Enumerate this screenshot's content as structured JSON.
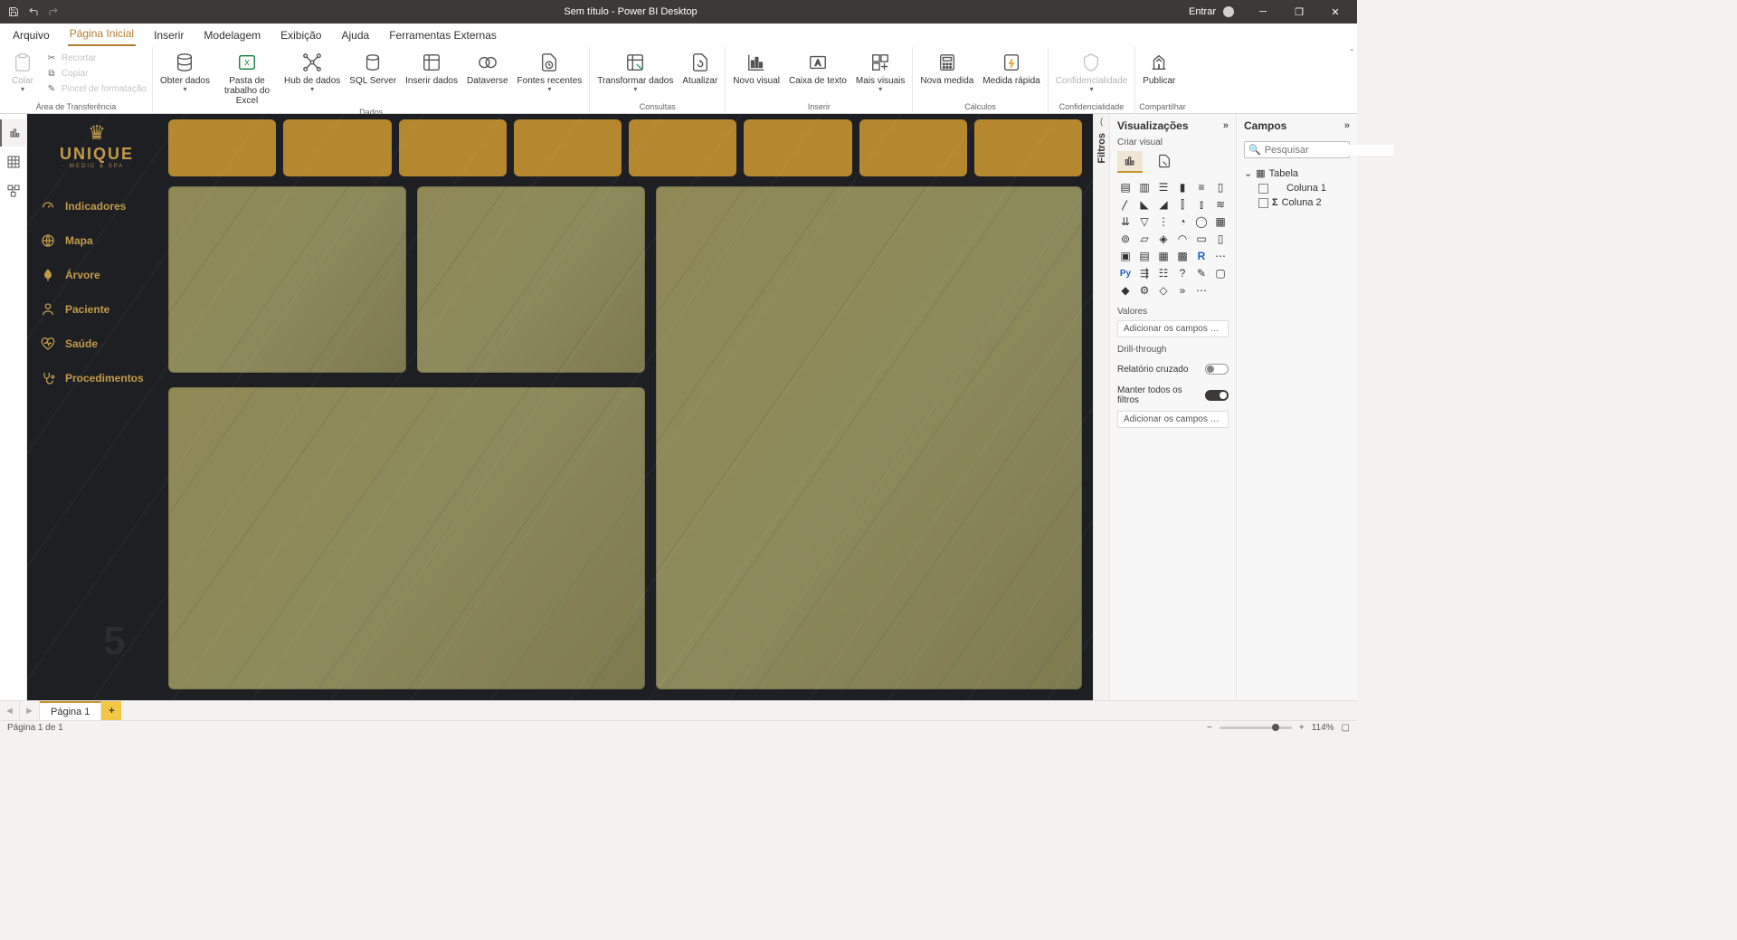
{
  "titlebar": {
    "title": "Sem título - Power BI Desktop",
    "signin": "Entrar"
  },
  "ribbonTabs": {
    "file": "Arquivo",
    "home": "Página Inicial",
    "insert": "Inserir",
    "modeling": "Modelagem",
    "view": "Exibição",
    "help": "Ajuda",
    "external": "Ferramentas Externas"
  },
  "ribbon": {
    "clipboard": {
      "paste": "Colar",
      "cut": "Recortar",
      "copy": "Copiar",
      "formatPainter": "Pincel de formatação",
      "group": "Área de Transferência"
    },
    "data": {
      "getData": "Obter dados",
      "excel": "Pasta de trabalho do Excel",
      "hub": "Hub de dados",
      "sql": "SQL Server",
      "enterData": "Inserir dados",
      "dataverse": "Dataverse",
      "recent": "Fontes recentes",
      "group": "Dados"
    },
    "queries": {
      "transform": "Transformar dados",
      "refresh": "Atualizar",
      "group": "Consultas"
    },
    "insert": {
      "newVisual": "Novo visual",
      "textbox": "Caixa de texto",
      "moreVisuals": "Mais visuais",
      "group": "Inserir"
    },
    "calc": {
      "newMeasure": "Nova medida",
      "quickMeasure": "Medida rápida",
      "group": "Cálculos"
    },
    "sensitivity": {
      "label": "Confidencialidade",
      "group": "Confidencialidade"
    },
    "share": {
      "publish": "Publicar",
      "group": "Compartilhar"
    }
  },
  "filtros": {
    "label": "Filtros"
  },
  "vizPanel": {
    "title": "Visualizações",
    "sub": "Criar visual",
    "valores": "Valores",
    "addFields": "Adicionar os campos de da...",
    "drill": "Drill-through",
    "crossReport": "Relatório cruzado",
    "keepFilters": "Manter todos os filtros",
    "addDrill": "Adicionar os campos de dr..."
  },
  "fieldsPanel": {
    "title": "Campos",
    "searchPlaceholder": "Pesquisar",
    "table": "Tabela",
    "col1": "Coluna 1",
    "col2": "Coluna 2"
  },
  "reportNav": {
    "brand": "UNIQUE",
    "tag": "· MEDIC & SPA ·",
    "items": {
      "indicadores": "Indicadores",
      "mapa": "Mapa",
      "arvore": "Árvore",
      "paciente": "Paciente",
      "saude": "Saúde",
      "procedimentos": "Procedimentos"
    },
    "watermark": "5"
  },
  "pageTabs": {
    "page1": "Página 1"
  },
  "status": {
    "pageInfo": "Página 1 de 1",
    "zoom": "114%"
  }
}
